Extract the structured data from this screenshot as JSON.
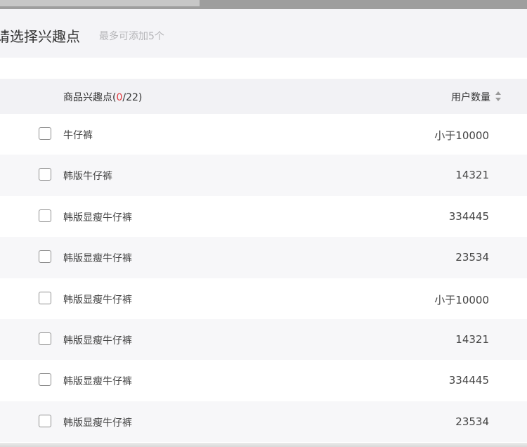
{
  "header": {
    "title": "请选择兴趣点",
    "hint": "最多可添加5个"
  },
  "table": {
    "name_column_prefix": "商品兴趣点(",
    "selected_count": "0",
    "name_column_suffix": "/22)",
    "users_column_label": "用户数量",
    "sort_icon": "sort-updown-icon",
    "rows": [
      {
        "name": "牛仔裤",
        "users": "小于10000",
        "checked": false
      },
      {
        "name": "韩版牛仔裤",
        "users": "14321",
        "checked": false
      },
      {
        "name": "韩版显瘦牛仔裤",
        "users": "334445",
        "checked": false
      },
      {
        "name": "韩版显瘦牛仔裤",
        "users": "23534",
        "checked": false
      },
      {
        "name": "韩版显瘦牛仔裤",
        "users": "小于10000",
        "checked": false
      },
      {
        "name": "韩版显瘦牛仔裤",
        "users": "14321",
        "checked": false
      },
      {
        "name": "韩版显瘦牛仔裤",
        "users": "334445",
        "checked": false
      },
      {
        "name": "韩版显瘦牛仔裤",
        "users": "23534",
        "checked": false
      }
    ]
  },
  "colors": {
    "header_bg": "#f4f4f7",
    "table_header_bg": "#f2f2f5",
    "alt_row_bg": "#f7f7f9",
    "selected_count": "#e0393e"
  }
}
